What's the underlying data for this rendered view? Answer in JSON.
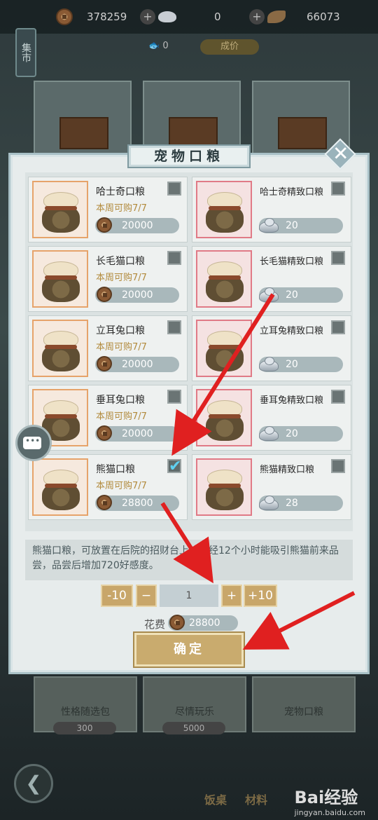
{
  "topbar": {
    "coins": "378259",
    "ingots": "0",
    "leaves": "66073",
    "fish_count": "0",
    "market_label": "集市",
    "gold_pill": "成价"
  },
  "dialog": {
    "title": "宠物口粮",
    "close_symbol": "✕",
    "items": [
      {
        "name": "哈士奇口粮",
        "limit": "本周可购7/7",
        "price": "20000",
        "currency": "coin",
        "checked": false
      },
      {
        "name": "哈士奇精致口粮",
        "limit": "",
        "price": "20",
        "currency": "silver",
        "checked": false
      },
      {
        "name": "长毛猫口粮",
        "limit": "本周可购7/7",
        "price": "20000",
        "currency": "coin",
        "checked": false
      },
      {
        "name": "长毛猫精致口粮",
        "limit": "",
        "price": "20",
        "currency": "silver",
        "checked": false
      },
      {
        "name": "立耳兔口粮",
        "limit": "本周可购7/7",
        "price": "20000",
        "currency": "coin",
        "checked": false
      },
      {
        "name": "立耳兔精致口粮",
        "limit": "",
        "price": "20",
        "currency": "silver",
        "checked": false
      },
      {
        "name": "垂耳兔口粮",
        "limit": "本周可购7/7",
        "price": "20000",
        "currency": "coin",
        "checked": false
      },
      {
        "name": "垂耳兔精致口粮",
        "limit": "",
        "price": "20",
        "currency": "silver",
        "checked": false
      },
      {
        "name": "熊猫口粮",
        "limit": "本周可购7/7",
        "price": "28800",
        "currency": "coin",
        "checked": true
      },
      {
        "name": "熊猫精致口粮",
        "limit": "",
        "price": "28",
        "currency": "silver",
        "checked": false
      }
    ],
    "description": "熊猫口粮，可放置在后院的招财台上。历经12个小时能吸引熊猫前来品尝，品尝后增加720好感度。",
    "qty": {
      "minus10": "-10",
      "minus": "−",
      "value": "1",
      "plus": "+",
      "plus10": "+10"
    },
    "cost_label": "花费",
    "cost_value": "28800",
    "confirm_label": "确定"
  },
  "background": {
    "bottom_items": [
      {
        "label": "性格随选包",
        "price": "300"
      },
      {
        "label": "尽情玩乐",
        "price": "5000"
      },
      {
        "label": "宠物口粮",
        "price": ""
      }
    ],
    "nav_labels": [
      "饭桌",
      "材料"
    ],
    "watermark": "Bai经验",
    "watermark_sub": "jingyan.baidu.com"
  }
}
